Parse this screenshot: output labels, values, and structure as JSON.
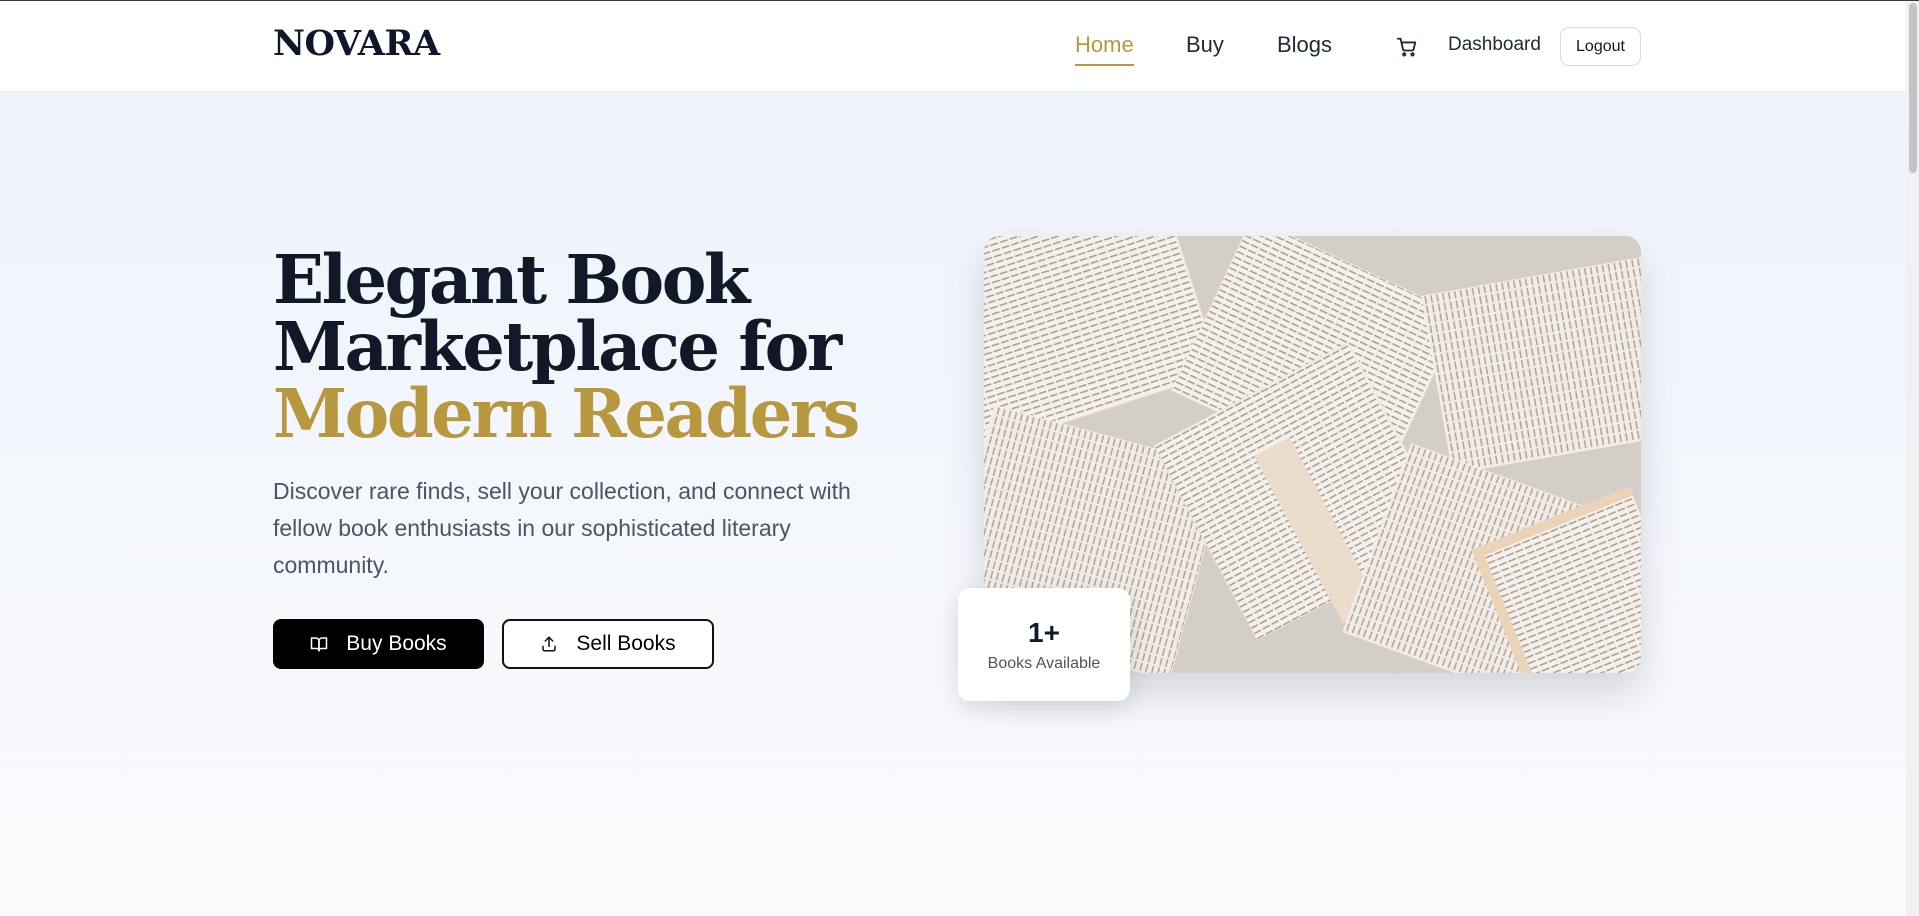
{
  "brand": {
    "name": "NOVARA",
    "accent_color": "#b8983f"
  },
  "nav": {
    "links": [
      {
        "label": "Home",
        "active": true
      },
      {
        "label": "Buy",
        "active": false
      },
      {
        "label": "Blogs",
        "active": false
      }
    ],
    "cart_icon": "shopping-cart-icon",
    "dashboard_label": "Dashboard",
    "logout_label": "Logout"
  },
  "hero": {
    "headline_line1": "Elegant Book",
    "headline_line2": "Marketplace for",
    "headline_accent": "Modern Readers",
    "subtext": "Discover rare finds, sell your collection, and connect with fellow book enthusiasts in our sophisticated literary community.",
    "primary_button": {
      "label": "Buy Books",
      "icon": "book-open-icon"
    },
    "secondary_button": {
      "label": "Sell Books",
      "icon": "upload-icon"
    },
    "image_subject": "open-books-pile",
    "stat": {
      "value": "1+",
      "label": "Books Available"
    }
  }
}
